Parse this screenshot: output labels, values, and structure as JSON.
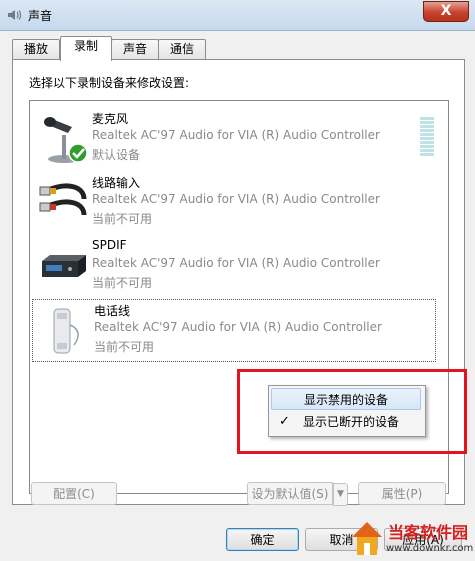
{
  "window": {
    "title": "声音",
    "close_label": "X"
  },
  "tabs": [
    {
      "label": "播放"
    },
    {
      "label": "录制"
    },
    {
      "label": "声音"
    },
    {
      "label": "通信"
    }
  ],
  "panel": {
    "instruction": "选择以下录制设备来修改设置:"
  },
  "devices": [
    {
      "name": "麦克风",
      "driver": "Realtek AC'97 Audio for VIA (R) Audio Controller",
      "status": "默认设备",
      "icon": "microphone-icon"
    },
    {
      "name": "线路输入",
      "driver": "Realtek AC'97 Audio for VIA (R) Audio Controller",
      "status": "当前不可用",
      "icon": "rca-cable-icon"
    },
    {
      "name": "SPDIF",
      "driver": "Realtek AC'97 Audio for VIA (R) Audio Controller",
      "status": "当前不可用",
      "icon": "spdif-device-icon"
    },
    {
      "name": "电话线",
      "driver": "Realtek AC'97 Audio for VIA (R) Audio Controller",
      "status": "当前不可用",
      "icon": "phone-handset-icon"
    }
  ],
  "context_menu": {
    "items": [
      {
        "label": "显示禁用的设备",
        "checked": false
      },
      {
        "label": "显示已断开的设备",
        "checked": true
      }
    ],
    "check_glyph": "✓"
  },
  "buttons": {
    "configure": "配置(C)",
    "set_default": "设为默认值(S)",
    "properties": "属性(P)",
    "ok": "确定",
    "cancel": "取消",
    "apply": "应用(A)"
  },
  "watermark": {
    "title": "当客软件园",
    "url": "www.downkr.com"
  },
  "colors": {
    "highlight_frame": "#e3141d",
    "disabled_text": "#8a8a8a"
  }
}
